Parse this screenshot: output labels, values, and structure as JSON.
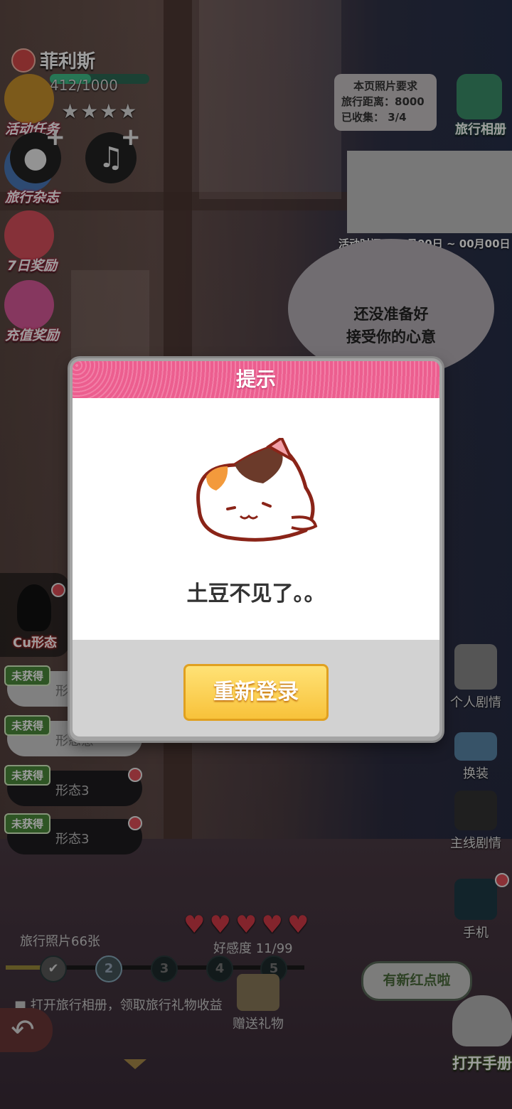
{
  "character": {
    "name": "菲利斯",
    "hp": "412/1000",
    "hp_fraction": 0.412,
    "stars": "★★★★"
  },
  "left_menu": [
    {
      "label": "活动任务"
    },
    {
      "label": "旅行杂志"
    },
    {
      "label": "7日奖励"
    },
    {
      "label": "充值奖励"
    }
  ],
  "requirement": {
    "title": "本页照片要求",
    "distance": "旅行距离：8000",
    "collected": "已收集：  3/4"
  },
  "album": {
    "label": "旅行相册"
  },
  "activity_time": "活动时间：00月00日 ~ 00月00日",
  "bubble": {
    "line1": "还没准备好",
    "line2": "接受你的心意"
  },
  "right_menu": [
    {
      "label": "个人剧情"
    },
    {
      "label": "换装"
    },
    {
      "label": "主线剧情"
    },
    {
      "label": "手机"
    }
  ],
  "cu_form": {
    "label": "Cu形态"
  },
  "forms": [
    {
      "tag": "未获得",
      "name": "形态意"
    },
    {
      "tag": "未获得",
      "name": "形态意"
    },
    {
      "tag": "未获得",
      "name": "形态3"
    },
    {
      "tag": "未获得",
      "name": "形态3"
    }
  ],
  "favor": {
    "text": "好感度 11/99",
    "hearts": "♥"
  },
  "photo_count": "旅行照片66张",
  "progress_nodes": [
    "✔",
    "2",
    "3",
    "4",
    "5"
  ],
  "hint": "■  打开旅行相册，领取旅行礼物收益",
  "gift": {
    "label": "赠送礼物"
  },
  "speech": "有新红点啦",
  "open_book": "打开手册",
  "modal": {
    "title": "提示",
    "message": "土豆不见了。。",
    "button": "重新登录"
  },
  "colors": {
    "accent_pink": "#ec5e8f",
    "button_yellow": "#f8c23a",
    "heart_red": "#d33a48"
  }
}
